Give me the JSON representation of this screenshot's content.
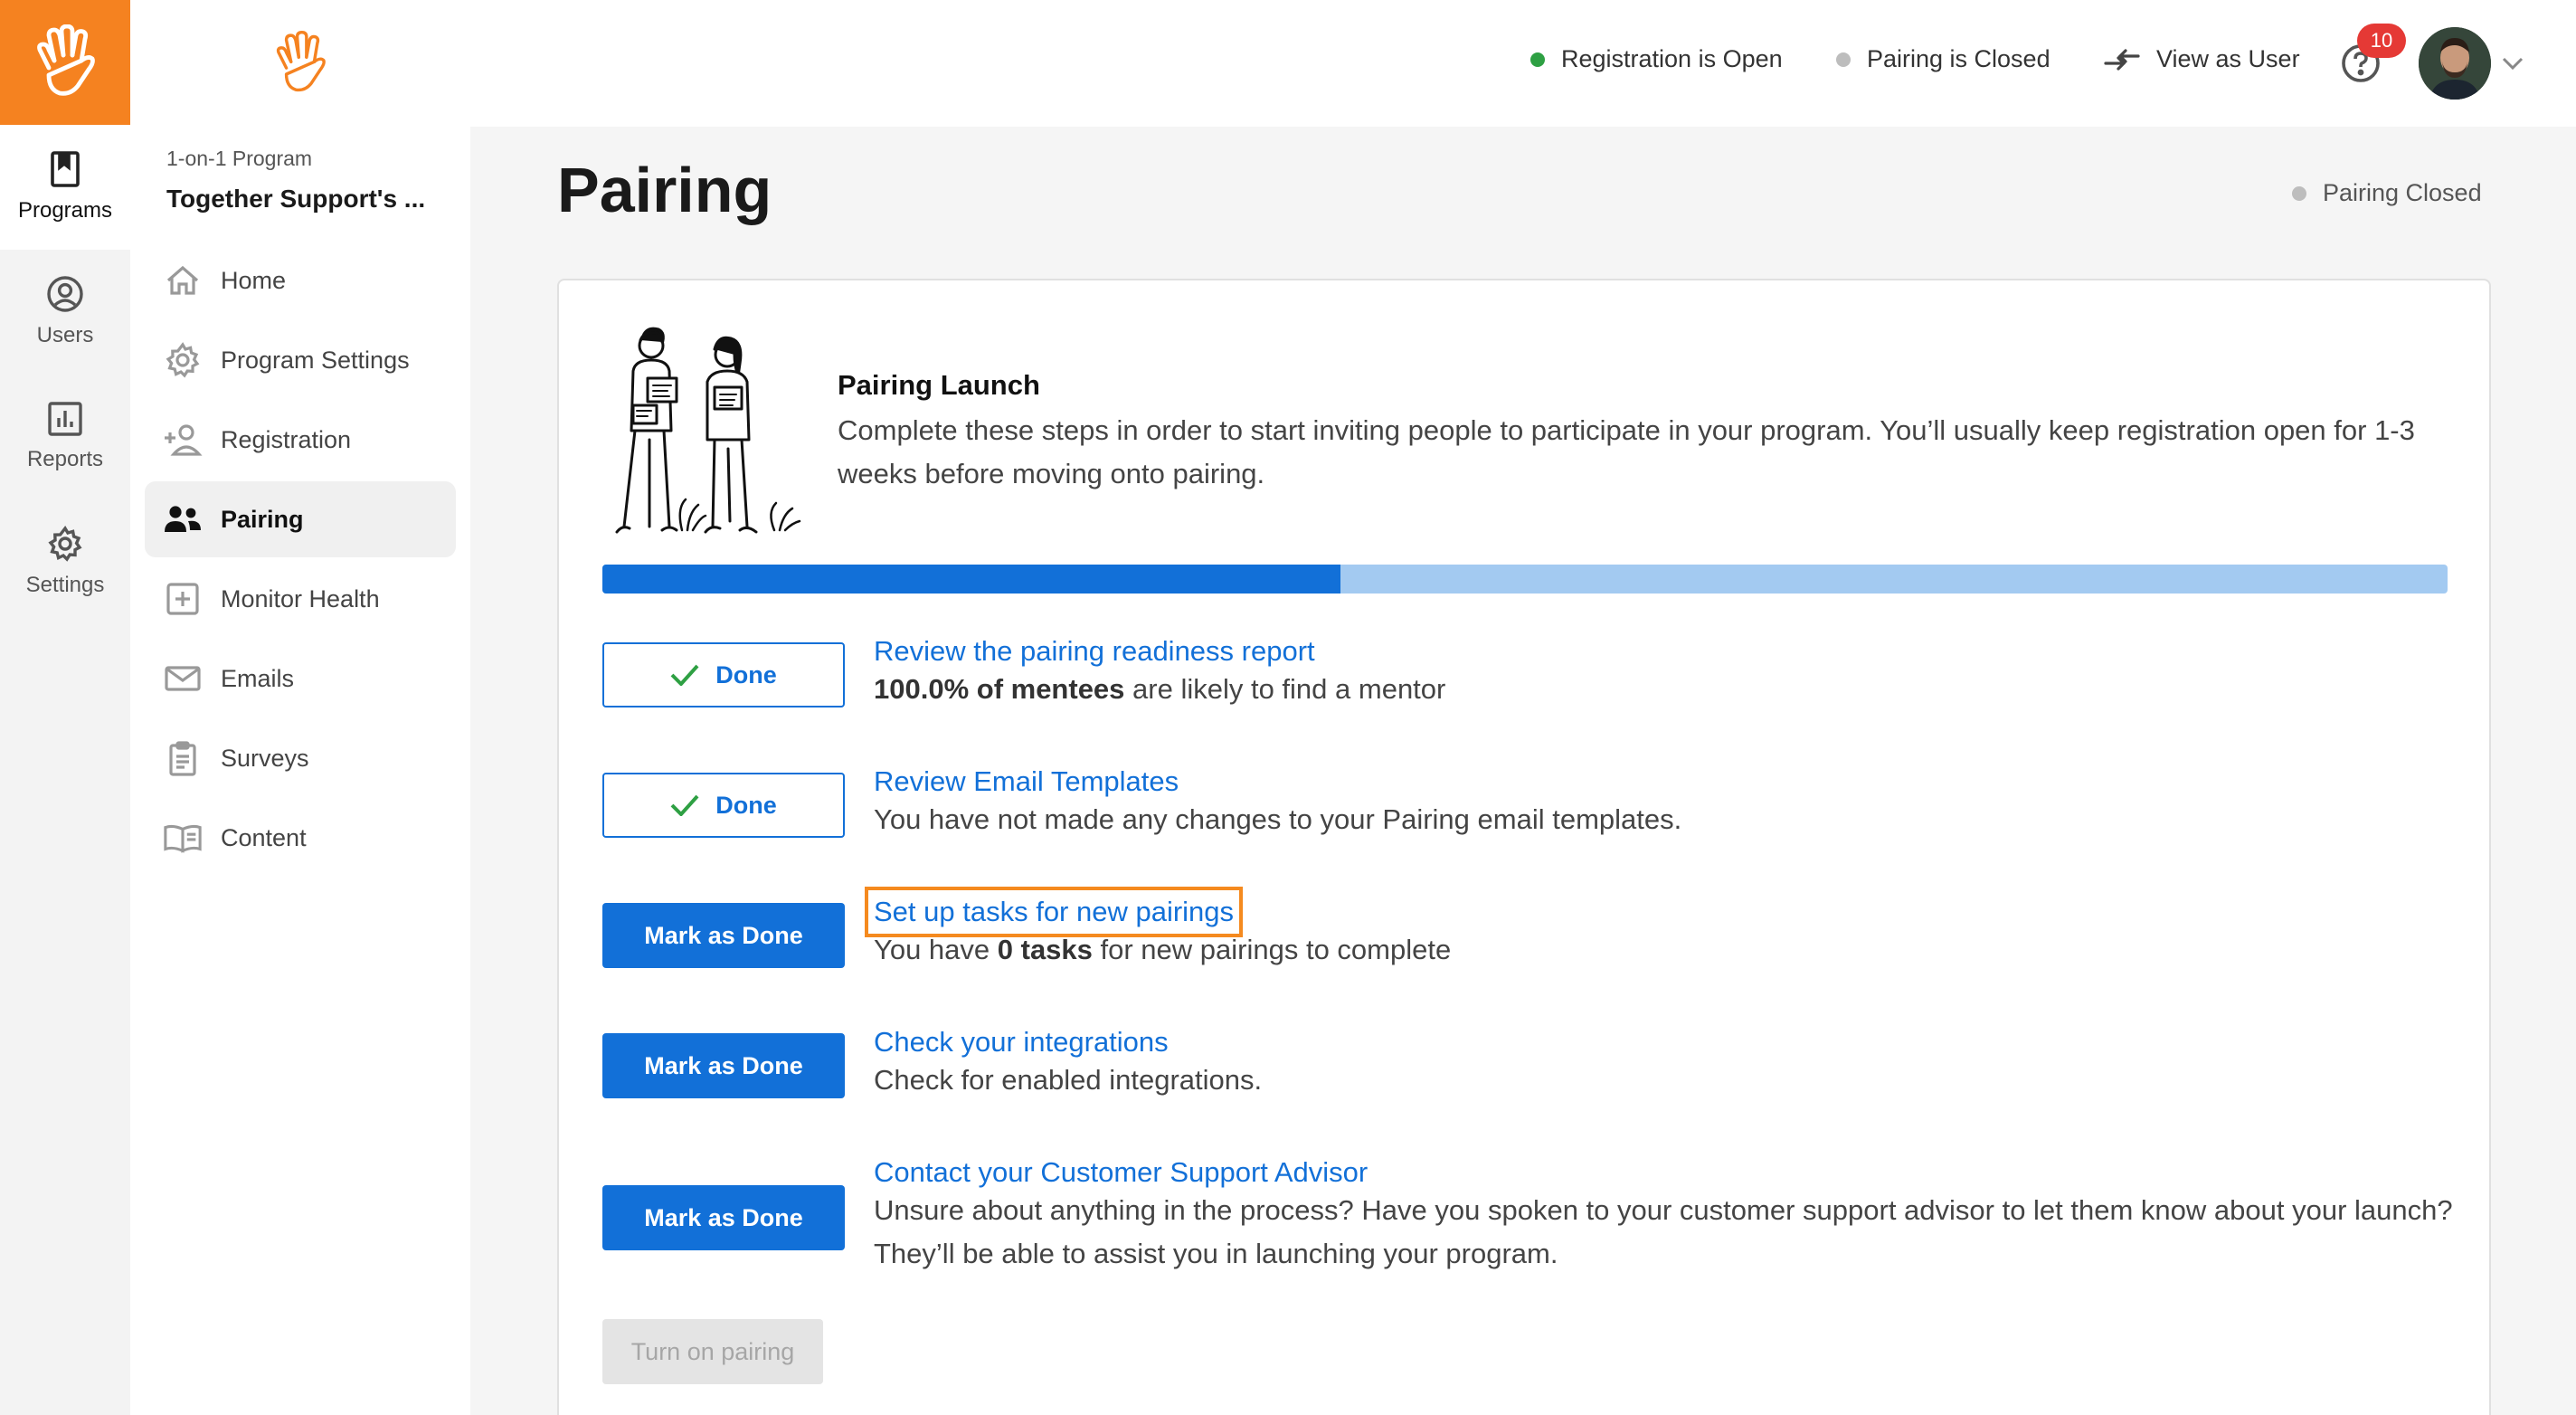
{
  "rail": {
    "items": [
      {
        "label": "Programs",
        "icon": "bookmark-icon"
      },
      {
        "label": "Users",
        "icon": "user-circle-icon"
      },
      {
        "label": "Reports",
        "icon": "bar-chart-icon"
      },
      {
        "label": "Settings",
        "icon": "gear-icon"
      }
    ]
  },
  "sidebar": {
    "program_type": "1-on-1 Program",
    "program_name": "Together Support's ...",
    "items": [
      {
        "label": "Home",
        "icon": "home-icon"
      },
      {
        "label": "Program Settings",
        "icon": "gear-icon"
      },
      {
        "label": "Registration",
        "icon": "add-user-icon"
      },
      {
        "label": "Pairing",
        "icon": "users-icon"
      },
      {
        "label": "Monitor Health",
        "icon": "plus-square-icon"
      },
      {
        "label": "Emails",
        "icon": "mail-icon"
      },
      {
        "label": "Surveys",
        "icon": "clipboard-icon"
      },
      {
        "label": "Content",
        "icon": "book-icon"
      }
    ]
  },
  "topbar": {
    "registration_status": "Registration is Open",
    "pairing_status": "Pairing is Closed",
    "view_as_user": "View as User",
    "notification_count": "10"
  },
  "main": {
    "title": "Pairing",
    "status": "Pairing Closed",
    "launch_title": "Pairing Launch",
    "launch_desc": "Complete these steps in order to start inviting people to participate in your program. You’ll usually keep registration open for 1-3 weeks before moving onto pairing.",
    "progress": 0.4
  },
  "steps": [
    {
      "button": "Done",
      "title": "Review the pairing readiness report",
      "desc_bold": "100.0% of mentees",
      "desc_rest": " are likely to find a mentor"
    },
    {
      "button": "Done",
      "title": "Review Email Templates",
      "desc": "You have not made any changes to your Pairing email templates."
    },
    {
      "button": "Mark as Done",
      "title": "Set up tasks for new pairings",
      "desc_pre": "You have ",
      "desc_bold": "0 tasks",
      "desc_rest": " for new pairings to complete"
    },
    {
      "button": "Mark as Done",
      "title": "Check your integrations",
      "desc": "Check for enabled integrations."
    },
    {
      "button": "Mark as Done",
      "title": "Contact your Customer Support Advisor",
      "desc": "Unsure about anything in the process? Have you spoken to your customer support advisor to let them know about your launch? They’ll be able to assist you in launching your program."
    }
  ],
  "turn_on_button": "Turn on pairing",
  "colors": {
    "accent": "#f58220",
    "primary": "#1270d8",
    "progress_bg": "#a3caf1",
    "open": "#2ea043",
    "closed": "#bdbdbd",
    "badge": "#e53935",
    "highlight": "#f58a1f"
  }
}
